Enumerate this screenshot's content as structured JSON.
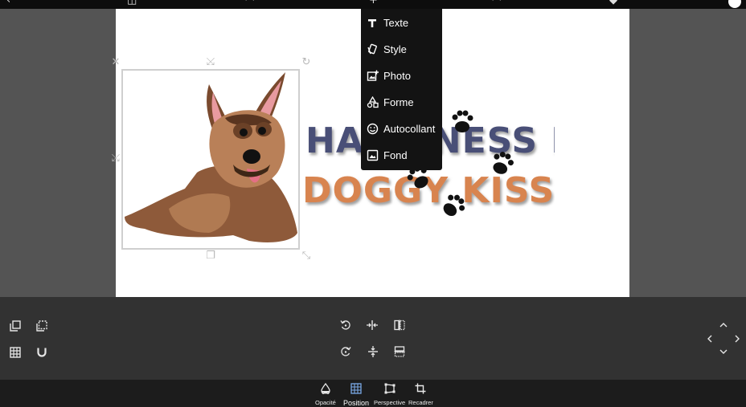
{
  "menu": {
    "items": [
      {
        "label": "Texte",
        "icon": "text-icon"
      },
      {
        "label": "Style",
        "icon": "style-icon"
      },
      {
        "label": "Photo",
        "icon": "add-photo-icon"
      },
      {
        "label": "Forme",
        "icon": "shapes-icon"
      },
      {
        "label": "Autocollant",
        "icon": "sticker-icon"
      },
      {
        "label": "Fond",
        "icon": "background-icon"
      }
    ]
  },
  "canvas": {
    "design_text_line1": "HAPPINESS IS",
    "design_text_line2": "DOGGY KISSES"
  },
  "tools": {
    "left": [
      "duplicate-layer-icon",
      "layer-select-icon",
      "grid-icon",
      "magnet-icon"
    ],
    "center": [
      "rotate-left-icon",
      "center-horizontal-icon",
      "flip-horizontal-icon",
      "rotate-right-icon",
      "center-vertical-icon",
      "flip-vertical-icon"
    ],
    "right": [
      "nudge-up-icon",
      "nudge-left-icon",
      "nudge-right-icon",
      "nudge-down-icon"
    ]
  },
  "bottom_nav": {
    "tabs": [
      {
        "label": "Opacité",
        "icon": "opacity-icon"
      },
      {
        "label": "Position",
        "icon": "position-grid-icon",
        "active": true
      },
      {
        "label": "Perspective",
        "icon": "perspective-icon"
      },
      {
        "label": "Recadrer",
        "icon": "crop-icon"
      }
    ]
  },
  "colors": {
    "background": "#545454",
    "canvas": "#ffffff",
    "menu": "#131313",
    "toolpanel": "#323232",
    "bottomnav": "#1c1c1c",
    "active_tab": "#7aa9e6",
    "text_navy": "#4a4f77",
    "text_orange": "#d8844f"
  }
}
